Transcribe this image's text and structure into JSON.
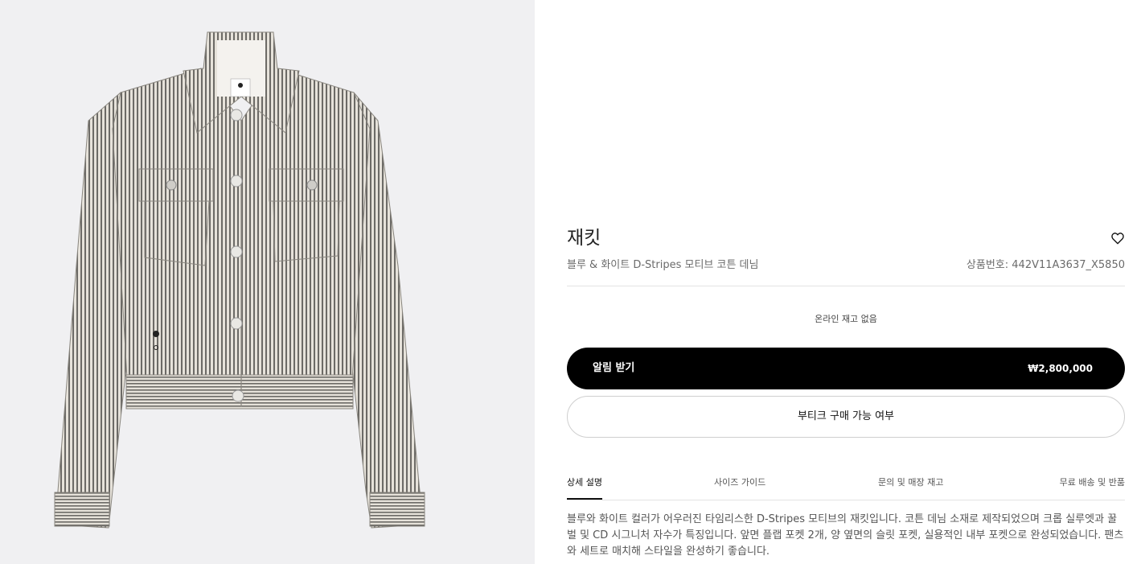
{
  "product": {
    "title": "재킷",
    "subtitle": "블루 & 화이트 D-Stripes 모티브 코튼 데님",
    "reference": "상품번호: 442V11A3637_X5850",
    "stock_status": "온라인 재고 없음",
    "notify_label": "알림 받기",
    "price": "₩2,800,000",
    "boutique_label": "부티크 구매 가능 여부",
    "image_alt": "Jacket product image"
  },
  "tabs": [
    {
      "label": "상세 설명",
      "active": true
    },
    {
      "label": "사이즈 가이드",
      "active": false
    },
    {
      "label": "문의 및 매장 재고",
      "active": false
    },
    {
      "label": "무료 배송 및 반품",
      "active": false
    }
  ],
  "description": "블루와 화이트 컬러가 어우러진 타임리스한 D-Stripes 모티브의 재킷입니다. 코튼 데님 소재로 제작되었으며 크롭 실루엣과 꿀벌 및 CD 시그니처 자수가 특징입니다. 앞면 플랩 포켓 2개, 양 옆면의 슬릿 포켓, 실용적인 내부 포켓으로 완성되었습니다. 팬츠와 세트로 매치해 스타일을 완성하기 좋습니다.",
  "icons": {
    "wishlist": "heart-outline-icon"
  },
  "colors": {
    "button_primary": "#000000",
    "image_background": "#f0f0f2"
  }
}
